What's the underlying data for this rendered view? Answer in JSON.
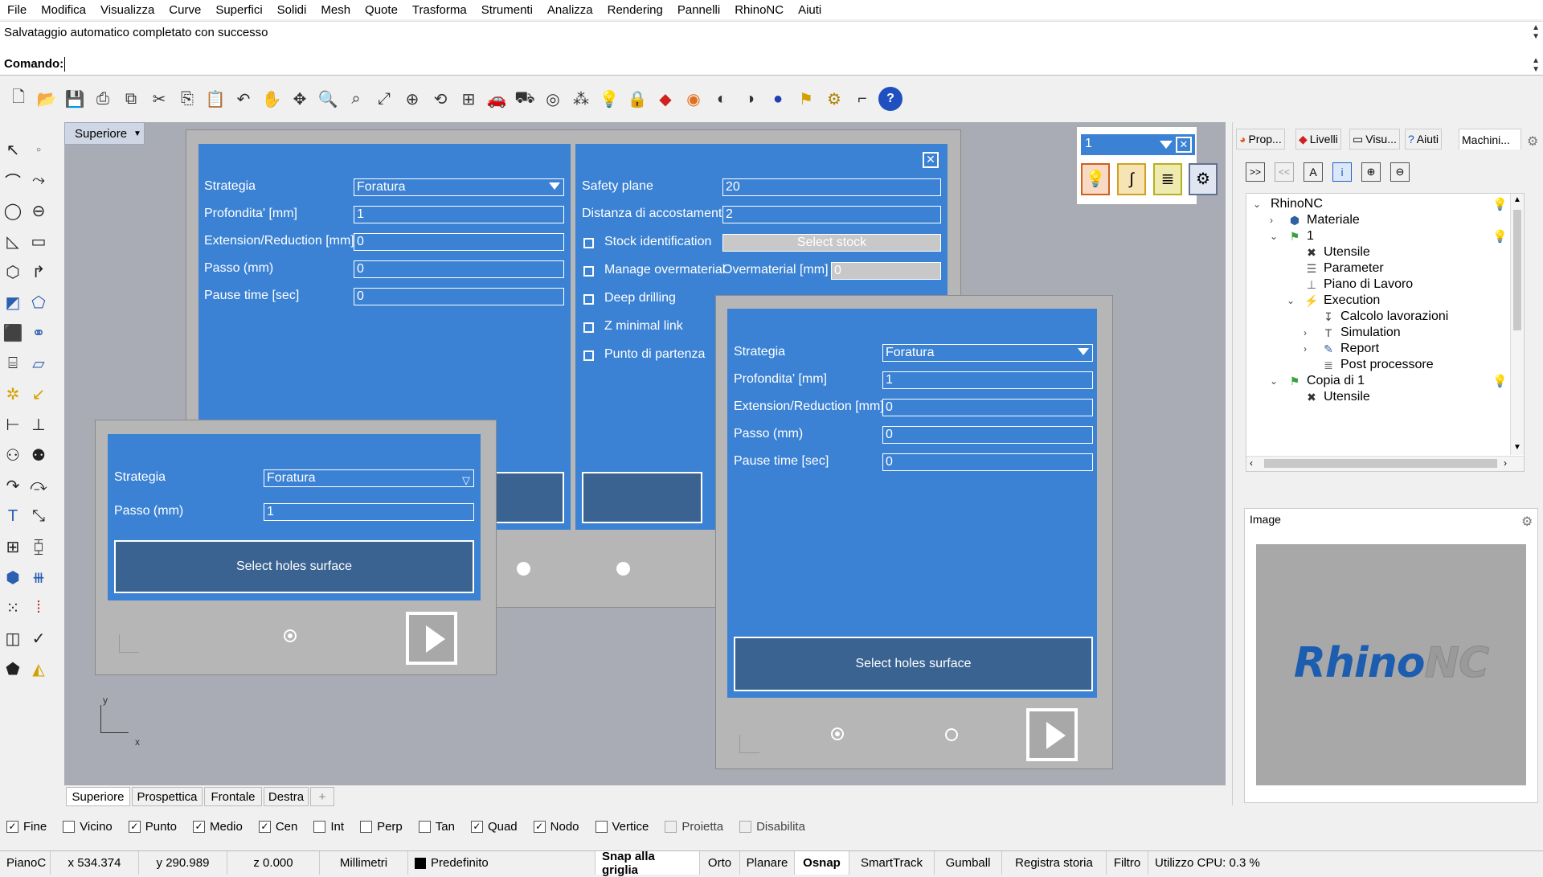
{
  "menu": [
    "File",
    "Modifica",
    "Visualizza",
    "Curve",
    "Superfici",
    "Solidi",
    "Mesh",
    "Quote",
    "Trasforma",
    "Strumenti",
    "Analizza",
    "Rendering",
    "Pannelli",
    "RhinoNC",
    "Aiuti"
  ],
  "command": {
    "history": "Salvataggio automatico completato con successo",
    "prompt_label": "Comando:"
  },
  "viewport": {
    "title": "Superiore",
    "axis_x": "x",
    "axis_y": "y"
  },
  "panel_back_left": {
    "fields": [
      {
        "label": "Strategia",
        "value": "Foratura",
        "type": "select"
      },
      {
        "label": "Profondita' [mm]",
        "value": "1"
      },
      {
        "label": "Extension/Reduction [mm]",
        "value": "0"
      },
      {
        "label": "Passo (mm)",
        "value": "0"
      },
      {
        "label": "Pause time [sec]",
        "value": "0"
      }
    ]
  },
  "panel_back_right": {
    "safety_label": "Safety plane",
    "safety_value": "20",
    "approach_label": "Distanza di accostamento",
    "approach_value": "2",
    "stock_label": "Stock identification",
    "select_stock": "Select stock",
    "overmat_label": "Manage overmaterial",
    "overmat_field_label": "Overmaterial [mm]",
    "overmat_value": "0",
    "deep_label": "Deep drilling",
    "zlink_label": "Z minimal link",
    "start_label": "Punto di partenza"
  },
  "panel_small": {
    "strategy_label": "Strategia",
    "strategy_value": "Foratura",
    "step_label": "Passo (mm)",
    "step_value": "1",
    "select_btn": "Select holes surface"
  },
  "panel_front": {
    "fields": [
      {
        "label": "Strategia",
        "value": "Foratura"
      },
      {
        "label": "Profondita' [mm]",
        "value": "1"
      },
      {
        "label": "Extension/Reduction [mm]",
        "value": "0"
      },
      {
        "label": "Passo (mm)",
        "value": "0"
      },
      {
        "label": "Pause time [sec]",
        "value": "0"
      }
    ],
    "select_btn": "Select holes surface"
  },
  "widget": {
    "value": "1"
  },
  "right_panel": {
    "tabs": [
      "Prop...",
      "Livelli",
      "Visu...",
      "Aiuti",
      "Machini..."
    ],
    "tree": [
      {
        "label": "RhinoNC",
        "indent": 0,
        "toggle": "⌄",
        "icon": "",
        "bulb": true
      },
      {
        "label": "Materiale",
        "indent": 1,
        "toggle": "›",
        "icon": "⬢",
        "bulb": false
      },
      {
        "label": "1",
        "indent": 1,
        "toggle": "⌄",
        "icon": "⚑",
        "bulb": true
      },
      {
        "label": "Utensile",
        "indent": 2,
        "toggle": "",
        "icon": "✖",
        "bulb": false
      },
      {
        "label": "Parameter",
        "indent": 2,
        "toggle": "",
        "icon": "☰",
        "bulb": false
      },
      {
        "label": "Piano di Lavoro",
        "indent": 2,
        "toggle": "",
        "icon": "⊥",
        "bulb": false
      },
      {
        "label": "Execution",
        "indent": 2,
        "toggle": "⌄",
        "icon": "⚡",
        "bulb": false
      },
      {
        "label": "Calcolo lavorazioni",
        "indent": 3,
        "toggle": "",
        "icon": "↧",
        "bulb": false
      },
      {
        "label": "Simulation",
        "indent": 3,
        "toggle": "›",
        "icon": "T",
        "bulb": false
      },
      {
        "label": "Report",
        "indent": 3,
        "toggle": "›",
        "icon": "✎",
        "bulb": false
      },
      {
        "label": "Post processore",
        "indent": 3,
        "toggle": "",
        "icon": "≣",
        "bulb": false
      },
      {
        "label": "Copia di 1",
        "indent": 1,
        "toggle": "⌄",
        "icon": "⚑",
        "bulb": true
      },
      {
        "label": "Utensile",
        "indent": 2,
        "toggle": "",
        "icon": "✖",
        "bulb": false
      }
    ],
    "image_title": "Image",
    "logo_rhino": "Rhino",
    "logo_nc": "NC"
  },
  "view_tabs": [
    "Superiore",
    "Prospettica",
    "Frontale",
    "Destra",
    "+"
  ],
  "osnaps": [
    {
      "label": "Fine",
      "checked": true,
      "disabled": false
    },
    {
      "label": "Vicino",
      "checked": false,
      "disabled": false
    },
    {
      "label": "Punto",
      "checked": true,
      "disabled": false
    },
    {
      "label": "Medio",
      "checked": true,
      "disabled": false
    },
    {
      "label": "Cen",
      "checked": true,
      "disabled": false
    },
    {
      "label": "Int",
      "checked": false,
      "disabled": false
    },
    {
      "label": "Perp",
      "checked": false,
      "disabled": false
    },
    {
      "label": "Tan",
      "checked": false,
      "disabled": false
    },
    {
      "label": "Quad",
      "checked": true,
      "disabled": false
    },
    {
      "label": "Nodo",
      "checked": true,
      "disabled": false
    },
    {
      "label": "Vertice",
      "checked": false,
      "disabled": false
    },
    {
      "label": "Proietta",
      "checked": false,
      "disabled": true
    },
    {
      "label": "Disabilita",
      "checked": false,
      "disabled": true
    }
  ],
  "status": {
    "plane": "PianoC",
    "x": "x 534.374",
    "y": "y 290.989",
    "z": "z 0.000",
    "units": "Millimetri",
    "layer": "Predefinito",
    "toggles": [
      "Snap alla griglia",
      "Orto",
      "Planare",
      "Osnap",
      "SmartTrack",
      "Gumball",
      "Registra storia",
      "Filtro"
    ],
    "cpu": "Utilizzo CPU: 0.3 %"
  },
  "colors": {
    "panel_blue": "#3b82d4",
    "button_blue": "#3a6391",
    "viewport": "#a9acb4",
    "logo_blue": "#1c5db0",
    "logo_grey": "#9a9a9a"
  }
}
